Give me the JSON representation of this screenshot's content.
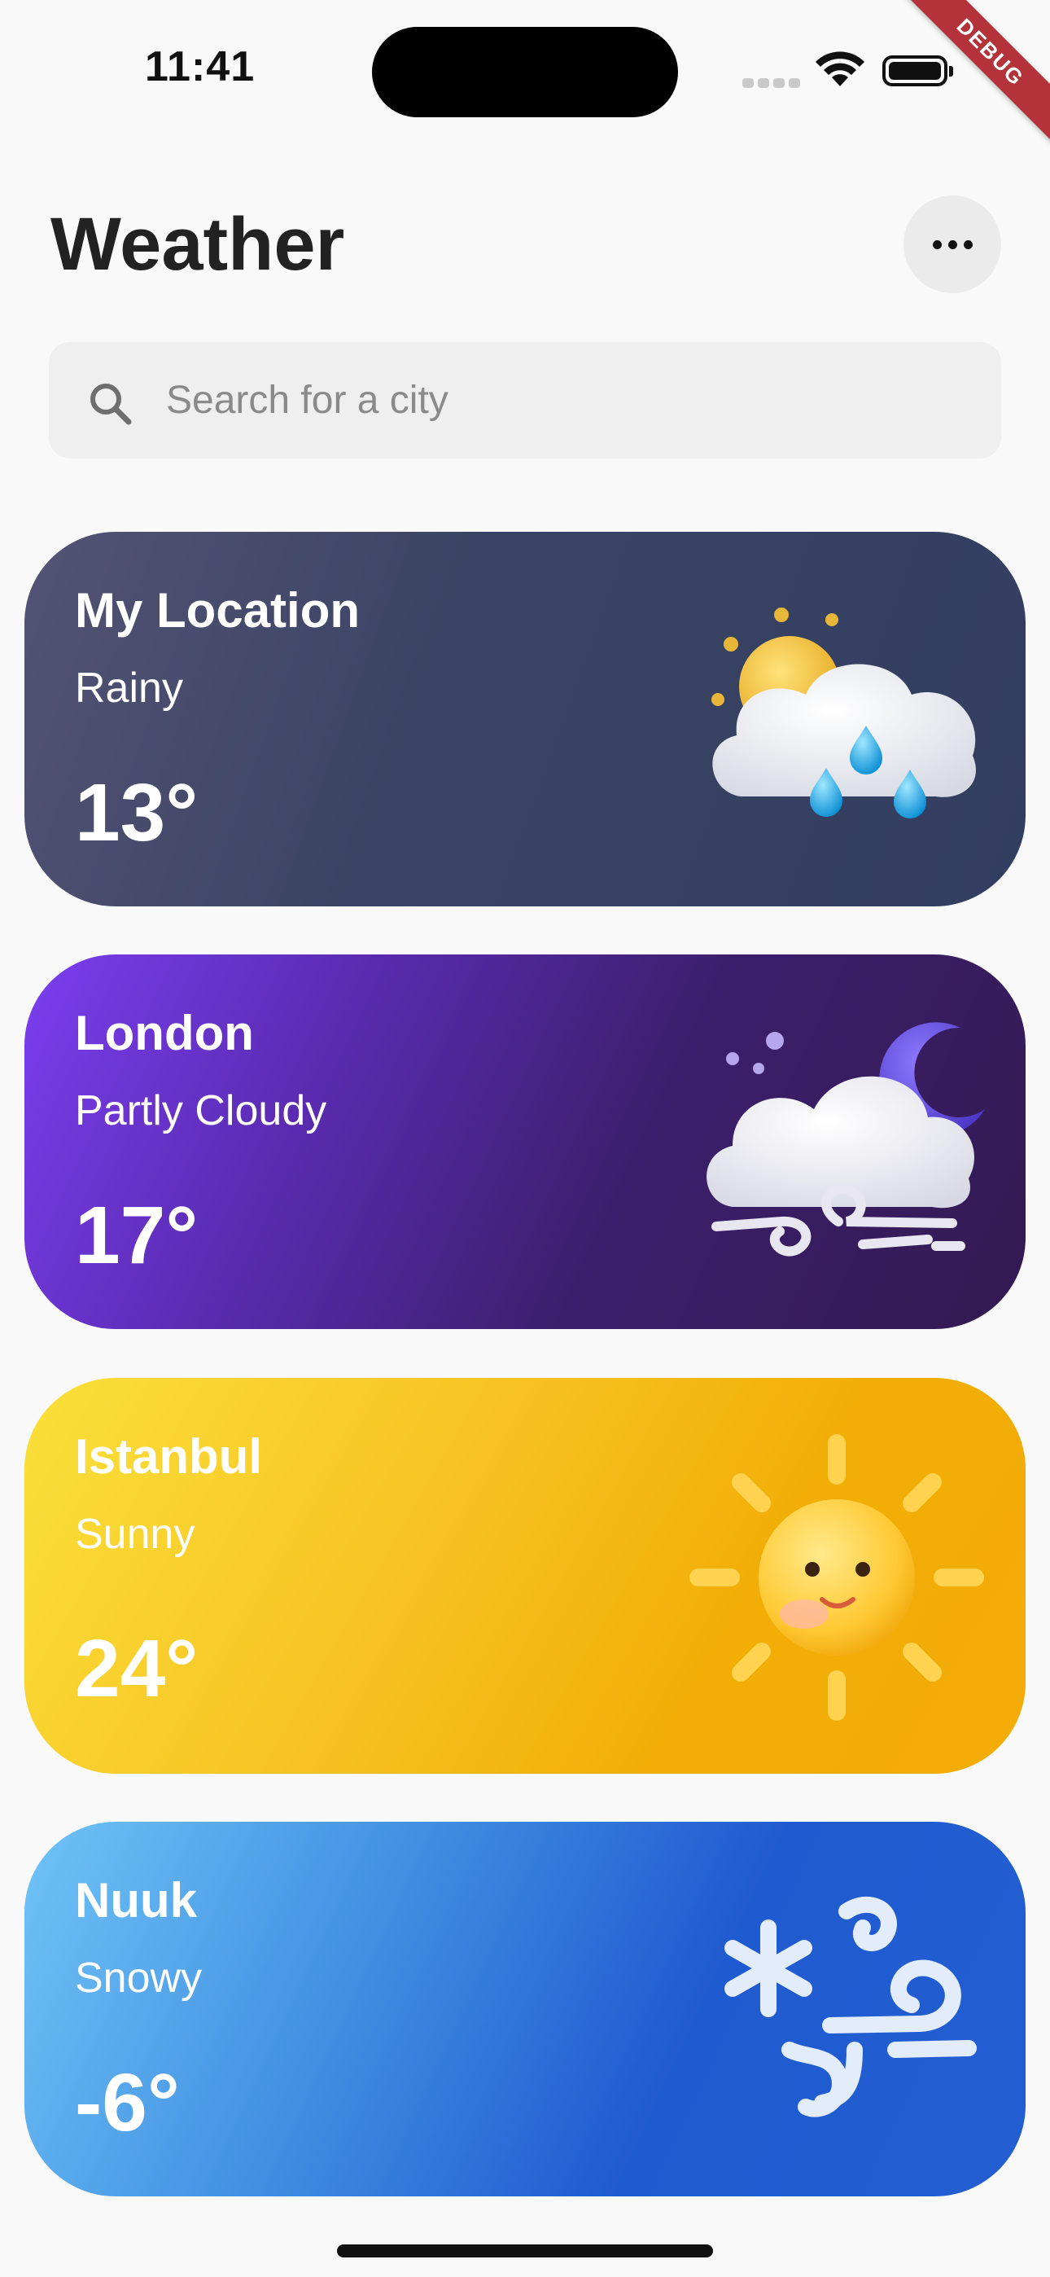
{
  "status_bar": {
    "time": "11:41"
  },
  "debug_label": "DEBUG",
  "header": {
    "title": "Weather"
  },
  "search": {
    "placeholder": "Search for a city",
    "value": ""
  },
  "cards": [
    {
      "city": "My Location",
      "condition": "Rainy",
      "temperature": "13°",
      "icon": "sun-cloud-rain-icon",
      "gradient": [
        "#545375",
        "#323e60"
      ]
    },
    {
      "city": "London",
      "condition": "Partly Cloudy",
      "temperature": "17°",
      "icon": "moon-cloud-wind-icon",
      "gradient": [
        "#7b3ef0",
        "#331a52"
      ]
    },
    {
      "city": "Istanbul",
      "condition": "Sunny",
      "temperature": "24°",
      "icon": "smiling-sun-icon",
      "gradient": [
        "#fbe03a",
        "#f2ad06"
      ]
    },
    {
      "city": "Nuuk",
      "condition": "Snowy",
      "temperature": "-6°",
      "icon": "snowflake-wind-icon",
      "gradient": [
        "#6fc4f6",
        "#1f5bd0"
      ]
    }
  ],
  "colors": {
    "background": "#f9f9f9",
    "title": "#222222",
    "search_bg": "#efefef",
    "debug_ribbon": "#b4333b"
  }
}
